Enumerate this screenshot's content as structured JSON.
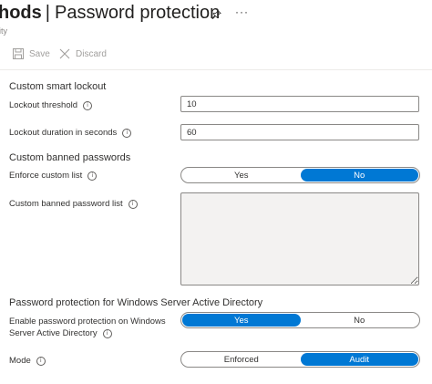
{
  "header": {
    "title_partial": "hods",
    "title_separator": "|",
    "title_main": "Password protection",
    "subtitle_partial": "ity"
  },
  "toolbar": {
    "save_label": "Save",
    "discard_label": "Discard"
  },
  "lockout": {
    "section_title": "Custom smart lockout",
    "threshold_label": "Lockout threshold",
    "threshold_value": "10",
    "duration_label": "Lockout duration in seconds",
    "duration_value": "60"
  },
  "banned": {
    "section_title": "Custom banned passwords",
    "enforce_label": "Enforce custom list",
    "enforce_options": [
      "Yes",
      "No"
    ],
    "enforce_selected": "No",
    "list_label": "Custom banned password list"
  },
  "windows": {
    "section_title": "Password protection for Windows Server Active Directory",
    "enable_label_line1": "Enable password protection on Windows",
    "enable_label_line2": "Server Active Directory",
    "enable_options": [
      "Yes",
      "No"
    ],
    "enable_selected": "Yes",
    "mode_label": "Mode",
    "mode_options": [
      "Enforced",
      "Audit"
    ],
    "mode_selected": "Audit"
  },
  "colors": {
    "accent": "#0078d4",
    "disabled_text": "#a19f9d",
    "textarea_bg": "#f3f2f1"
  }
}
